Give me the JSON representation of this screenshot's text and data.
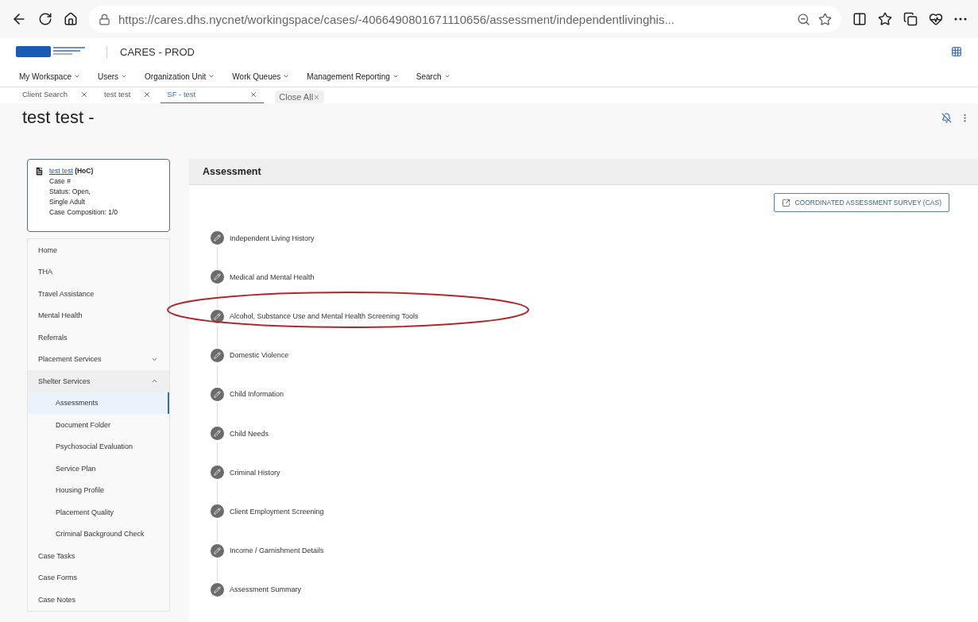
{
  "browser": {
    "url": "https://cares.dhs.nycnet/workingspace/cases/-4066490801671110656/assessment/independentlivinghis..."
  },
  "header": {
    "app_title": "CARES - PROD"
  },
  "nav": [
    "My Workspace",
    "Users",
    "Organization Unit",
    "Work Queues",
    "Management Reporting",
    "Search"
  ],
  "tabs": [
    {
      "label": "Client Search",
      "selected": false
    },
    {
      "label": "test test",
      "selected": false
    },
    {
      "label": "SF - test",
      "selected": true
    }
  ],
  "close_all": "Close All",
  "page_title": "test test -",
  "case_card": {
    "name": "test test",
    "role": "(HoC)",
    "lines": [
      "Case #",
      "Status: Open,",
      "Single Adult",
      "Case Composition: 1/0"
    ]
  },
  "sidebar": [
    {
      "label": "Home"
    },
    {
      "label": "THA"
    },
    {
      "label": "Travel Assistance"
    },
    {
      "label": "Mental Health"
    },
    {
      "label": "Referrals"
    },
    {
      "label": "Placement Services",
      "expanded": false
    },
    {
      "label": "Shelter Services",
      "expanded": true,
      "children": [
        {
          "label": "Assessments",
          "selected": true
        },
        {
          "label": "Document Folder",
          "selected": false
        },
        {
          "label": "Psychosocial Evaluation",
          "selected": false
        },
        {
          "label": "Service Plan",
          "selected": false
        },
        {
          "label": "Housing Profile",
          "selected": false
        },
        {
          "label": "Placement Quality",
          "selected": false
        },
        {
          "label": "Criminal Background Check",
          "selected": false
        }
      ]
    },
    {
      "label": "Case Tasks"
    },
    {
      "label": "Case Forms"
    },
    {
      "label": "Case Notes"
    }
  ],
  "panel": {
    "title": "Assessment",
    "button": "COORDINATED ASSESSMENT SURVEY (CAS)",
    "steps": [
      {
        "label": "Independent Living History",
        "circled": false
      },
      {
        "label": "Medical and Mental Health",
        "circled": false
      },
      {
        "label": "Alcohol, Substance Use and Mental Health Screening Tools",
        "circled": true
      },
      {
        "label": "Domestic Violence",
        "circled": false
      },
      {
        "label": "Child Information",
        "circled": false
      },
      {
        "label": "Child Needs",
        "circled": false
      },
      {
        "label": "Criminal History",
        "circled": false
      },
      {
        "label": "Client Employment Screening",
        "circled": false
      },
      {
        "label": "Income / Garnishment Details",
        "circled": false
      },
      {
        "label": "Assessment Summary",
        "circled": false
      }
    ]
  }
}
